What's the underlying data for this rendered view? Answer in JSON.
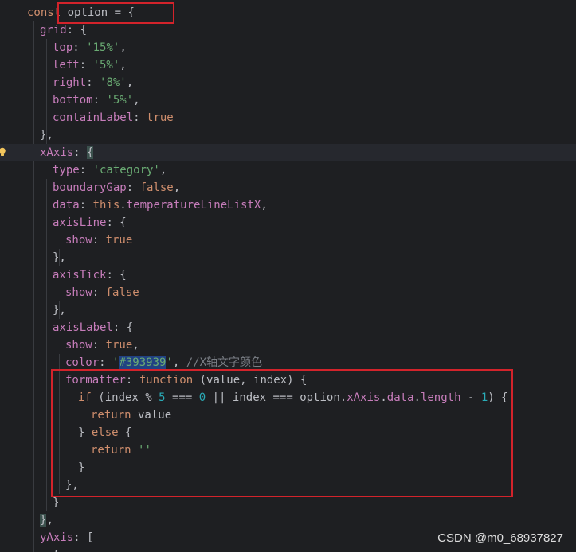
{
  "code_lines": [
    {
      "tokens": [
        {
          "t": "const ",
          "c": "kw"
        },
        {
          "t": "option",
          "c": "plain"
        },
        {
          "t": " = {",
          "c": "plain"
        }
      ]
    },
    {
      "tokens": [
        {
          "t": "grid",
          "c": "prop"
        },
        {
          "t": ": {",
          "c": "plain"
        }
      ]
    },
    {
      "tokens": [
        {
          "t": "top",
          "c": "prop"
        },
        {
          "t": ": ",
          "c": "plain"
        },
        {
          "t": "'15%'",
          "c": "str"
        },
        {
          "t": ",",
          "c": "plain"
        }
      ]
    },
    {
      "tokens": [
        {
          "t": "left",
          "c": "prop"
        },
        {
          "t": ": ",
          "c": "plain"
        },
        {
          "t": "'5%'",
          "c": "str"
        },
        {
          "t": ",",
          "c": "plain"
        }
      ]
    },
    {
      "tokens": [
        {
          "t": "right",
          "c": "prop"
        },
        {
          "t": ": ",
          "c": "plain"
        },
        {
          "t": "'8%'",
          "c": "str"
        },
        {
          "t": ",",
          "c": "plain"
        }
      ]
    },
    {
      "tokens": [
        {
          "t": "bottom",
          "c": "prop"
        },
        {
          "t": ": ",
          "c": "plain"
        },
        {
          "t": "'5%'",
          "c": "str"
        },
        {
          "t": ",",
          "c": "plain"
        }
      ]
    },
    {
      "tokens": [
        {
          "t": "containLabel",
          "c": "prop"
        },
        {
          "t": ": ",
          "c": "plain"
        },
        {
          "t": "true",
          "c": "kw"
        }
      ]
    },
    {
      "tokens": [
        {
          "t": "},",
          "c": "plain"
        }
      ]
    },
    {
      "tokens": [
        {
          "t": "xAxis",
          "c": "prop"
        },
        {
          "t": ": ",
          "c": "plain"
        },
        {
          "t": "{",
          "c": "brace-match"
        }
      ]
    },
    {
      "tokens": [
        {
          "t": "type",
          "c": "prop"
        },
        {
          "t": ": ",
          "c": "plain"
        },
        {
          "t": "'category'",
          "c": "str"
        },
        {
          "t": ",",
          "c": "plain"
        }
      ]
    },
    {
      "tokens": [
        {
          "t": "boundaryGap",
          "c": "prop"
        },
        {
          "t": ": ",
          "c": "plain"
        },
        {
          "t": "false",
          "c": "kw"
        },
        {
          "t": ",",
          "c": "plain"
        }
      ]
    },
    {
      "tokens": [
        {
          "t": "data",
          "c": "prop"
        },
        {
          "t": ": ",
          "c": "plain"
        },
        {
          "t": "this",
          "c": "kw"
        },
        {
          "t": ".",
          "c": "plain"
        },
        {
          "t": "temperatureLineListX",
          "c": "prop"
        },
        {
          "t": ",",
          "c": "plain"
        }
      ]
    },
    {
      "tokens": [
        {
          "t": "axisLine",
          "c": "prop"
        },
        {
          "t": ": {",
          "c": "plain"
        }
      ]
    },
    {
      "tokens": [
        {
          "t": "show",
          "c": "prop"
        },
        {
          "t": ": ",
          "c": "plain"
        },
        {
          "t": "true",
          "c": "kw"
        }
      ]
    },
    {
      "tokens": [
        {
          "t": "},",
          "c": "plain"
        }
      ]
    },
    {
      "tokens": [
        {
          "t": "axisTick",
          "c": "prop"
        },
        {
          "t": ": {",
          "c": "plain"
        }
      ]
    },
    {
      "tokens": [
        {
          "t": "show",
          "c": "prop"
        },
        {
          "t": ": ",
          "c": "plain"
        },
        {
          "t": "false",
          "c": "kw"
        }
      ]
    },
    {
      "tokens": [
        {
          "t": "},",
          "c": "plain"
        }
      ]
    },
    {
      "tokens": [
        {
          "t": "axisLabel",
          "c": "prop"
        },
        {
          "t": ": {",
          "c": "plain"
        }
      ]
    },
    {
      "tokens": [
        {
          "t": "show",
          "c": "prop"
        },
        {
          "t": ": ",
          "c": "plain"
        },
        {
          "t": "true",
          "c": "kw"
        },
        {
          "t": ",",
          "c": "plain"
        }
      ]
    },
    {
      "tokens": [
        {
          "t": "color",
          "c": "prop"
        },
        {
          "t": ": ",
          "c": "plain"
        },
        {
          "t": "'",
          "c": "str"
        },
        {
          "t": "#393939",
          "c": "hexsel"
        },
        {
          "t": "'",
          "c": "str"
        },
        {
          "t": ", ",
          "c": "plain"
        },
        {
          "t": "//X轴文字颜色",
          "c": "cmt"
        }
      ]
    },
    {
      "tokens": [
        {
          "t": "formatter",
          "c": "prop"
        },
        {
          "t": ": ",
          "c": "plain"
        },
        {
          "t": "function",
          "c": "kw"
        },
        {
          "t": " (value, index) {",
          "c": "plain"
        }
      ]
    },
    {
      "tokens": [
        {
          "t": "if",
          "c": "kw"
        },
        {
          "t": " (index % ",
          "c": "plain"
        },
        {
          "t": "5",
          "c": "num"
        },
        {
          "t": " === ",
          "c": "plain"
        },
        {
          "t": "0",
          "c": "num"
        },
        {
          "t": " || index === option.",
          "c": "plain"
        },
        {
          "t": "xAxis",
          "c": "prop"
        },
        {
          "t": ".",
          "c": "plain"
        },
        {
          "t": "data",
          "c": "prop"
        },
        {
          "t": ".",
          "c": "plain"
        },
        {
          "t": "length",
          "c": "prop"
        },
        {
          "t": " - ",
          "c": "plain"
        },
        {
          "t": "1",
          "c": "num"
        },
        {
          "t": ") {",
          "c": "plain"
        }
      ]
    },
    {
      "tokens": [
        {
          "t": "return",
          "c": "kw"
        },
        {
          "t": " value",
          "c": "plain"
        }
      ]
    },
    {
      "tokens": [
        {
          "t": "} ",
          "c": "plain"
        },
        {
          "t": "else",
          "c": "kw"
        },
        {
          "t": " {",
          "c": "plain"
        }
      ]
    },
    {
      "tokens": [
        {
          "t": "return",
          "c": "kw"
        },
        {
          "t": " ",
          "c": "plain"
        },
        {
          "t": "''",
          "c": "str"
        }
      ]
    },
    {
      "tokens": [
        {
          "t": "}",
          "c": "plain"
        }
      ]
    },
    {
      "tokens": [
        {
          "t": "},",
          "c": "plain"
        }
      ]
    },
    {
      "tokens": [
        {
          "t": "}",
          "c": "plain"
        }
      ]
    },
    {
      "tokens": [
        {
          "t": "}",
          "c": "brace-match"
        },
        {
          "t": ",",
          "c": "plain"
        }
      ]
    },
    {
      "tokens": [
        {
          "t": "yAxis",
          "c": "prop"
        },
        {
          "t": ": [",
          "c": "plain"
        }
      ]
    },
    {
      "tokens": [
        {
          "t": "{",
          "c": "plain"
        }
      ]
    }
  ],
  "highlighted_line_index": 8,
  "watermark": "CSDN @m0_68937827",
  "colors": {
    "background": "#1e1f22",
    "keyword": "#cf8e6d",
    "property": "#c77dbb",
    "string": "#6aab73",
    "number": "#2aacb8",
    "comment": "#7a7e85",
    "annotation_box": "#d3232b"
  },
  "icons": {
    "gutter_marker": "lightbulb-icon"
  }
}
